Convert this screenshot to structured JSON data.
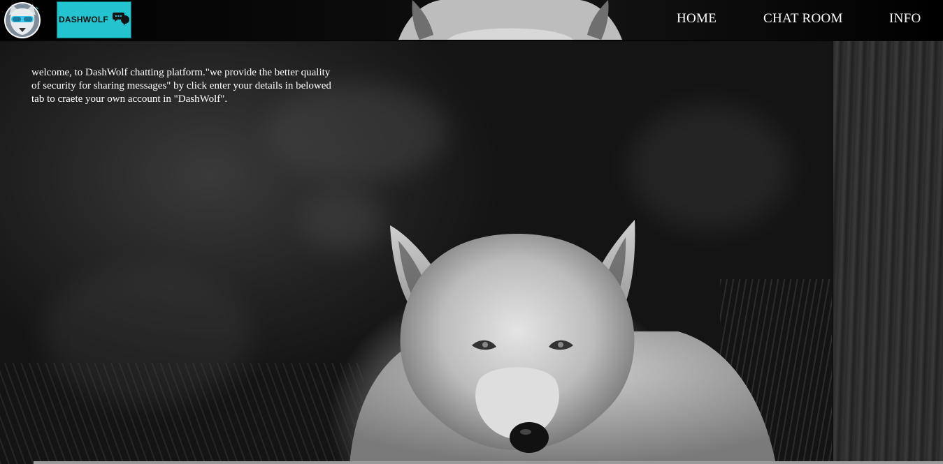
{
  "header": {
    "logo_icon": "wolf-mascot-icon",
    "brand": {
      "text": "DASHWOLF",
      "background_color": "#23c4cf",
      "icon": "chat-bubbles-icon"
    },
    "nav": {
      "home": "HOME",
      "chat_room": "CHAT ROOM",
      "info": "INFO"
    }
  },
  "main": {
    "welcome_text": "welcome, to DashWolf chatting platform.\"we provide the better quality of security for sharing messages\" by click enter your details in belowed tab to craete your own account in \"DashWolf\".",
    "background_image": "wolf-photo"
  }
}
